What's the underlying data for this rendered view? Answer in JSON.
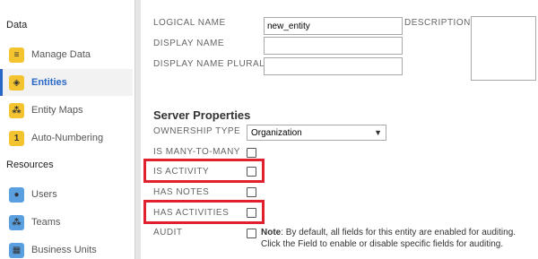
{
  "sidebar": {
    "data_title": "Data",
    "resources_title": "Resources",
    "data_items": [
      {
        "label": "Manage Data",
        "icon": "database-icon",
        "glyph": "≡"
      },
      {
        "label": "Entities",
        "icon": "cube-icon",
        "glyph": "◈"
      },
      {
        "label": "Entity Maps",
        "icon": "entity-map-icon",
        "glyph": "⁂"
      },
      {
        "label": "Auto-Numbering",
        "icon": "number-icon",
        "glyph": "1"
      }
    ],
    "resource_items": [
      {
        "label": "Users",
        "icon": "user-icon",
        "glyph": "●"
      },
      {
        "label": "Teams",
        "icon": "team-icon",
        "glyph": "⁂"
      },
      {
        "label": "Business Units",
        "icon": "business-unit-icon",
        "glyph": "▦"
      }
    ]
  },
  "form": {
    "logical_name_label": "LOGICAL NAME",
    "logical_name_value": "new_entity",
    "display_name_label": "DISPLAY NAME",
    "display_name_value": "",
    "display_name_plural_label": "DISPLAY NAME PLURAL",
    "display_name_plural_value": "",
    "description_label": "DESCRIPTION"
  },
  "server_properties": {
    "heading": "Server Properties",
    "ownership_type_label": "OWNERSHIP TYPE",
    "ownership_type_value": "Organization",
    "is_many_to_many_label": "IS MANY-TO-MANY",
    "is_activity_label": "IS ACTIVITY",
    "has_notes_label": "HAS NOTES",
    "has_activities_label": "HAS ACTIVITIES",
    "audit_label": "AUDIT",
    "audit_note_bold": "Note",
    "audit_note_text": ": By default, all fields for this entity are enabled for auditing. Click the Field to enable or disable specific fields for auditing."
  },
  "colors": {
    "accent": "#2a68c8",
    "highlight": "#e0212d",
    "icon_yellow": "#f4c430",
    "icon_blue": "#5aa0e0"
  }
}
